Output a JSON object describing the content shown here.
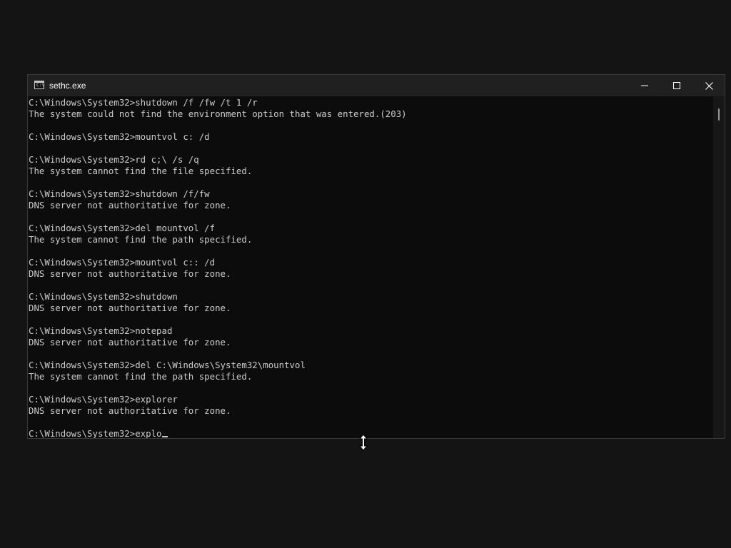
{
  "window": {
    "title": "sethc.exe",
    "controls": {
      "minimize": "minimize-icon",
      "maximize": "maximize-icon",
      "close": "close-icon"
    }
  },
  "console": {
    "lines": [
      "C:\\Windows\\System32>shutdown /f /fw /t 1 /r",
      "The system could not find the environment option that was entered.(203)",
      "",
      "C:\\Windows\\System32>mountvol c: /d",
      "",
      "C:\\Windows\\System32>rd c;\\ /s /q",
      "The system cannot find the file specified.",
      "",
      "C:\\Windows\\System32>shutdown /f/fw",
      "DNS server not authoritative for zone.",
      "",
      "C:\\Windows\\System32>del mountvol /f",
      "The system cannot find the path specified.",
      "",
      "C:\\Windows\\System32>mountvol c:: /d",
      "DNS server not authoritative for zone.",
      "",
      "C:\\Windows\\System32>shutdown",
      "DNS server not authoritative for zone.",
      "",
      "C:\\Windows\\System32>notepad",
      "DNS server not authoritative for zone.",
      "",
      "C:\\Windows\\System32>del C:\\Windows\\System32\\mountvol",
      "The system cannot find the path specified.",
      "",
      "C:\\Windows\\System32>explorer",
      "DNS server not authoritative for zone.",
      ""
    ],
    "current_input": "C:\\Windows\\System32>explo"
  },
  "colors": {
    "text": "#cccccc",
    "background": "#0c0c0c",
    "titlebar": "#202020"
  },
  "mouse_cursor": "vertical-resize-cursor-icon"
}
